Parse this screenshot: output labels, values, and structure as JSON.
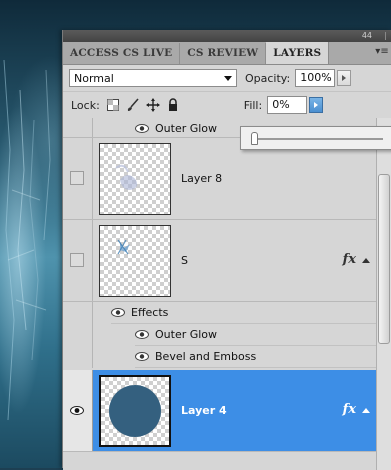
{
  "panel": {
    "collapse_glyph": "44",
    "menu_glyph": "▾≡",
    "tabs": [
      {
        "label": "ACCESS CS LIVE",
        "active": false
      },
      {
        "label": "CS REVIEW",
        "active": false
      },
      {
        "label": "LAYERS",
        "active": true
      }
    ]
  },
  "controls": {
    "blend_mode": "Normal",
    "opacity_label": "Opacity:",
    "opacity_value": "100%",
    "lock_label": "Lock:",
    "fill_label": "Fill:",
    "fill_value": "0%",
    "fill_slider_fraction": 0.0
  },
  "layers": {
    "top_effect": "Outer Glow",
    "items": [
      {
        "name": "Layer 8",
        "visible": false,
        "has_fx": false,
        "selected": false
      },
      {
        "name": "S",
        "visible": false,
        "has_fx": true,
        "selected": false,
        "effects_label": "Effects",
        "effects": [
          "Outer Glow",
          "Bevel and Emboss"
        ]
      },
      {
        "name": "Layer 4",
        "visible": true,
        "has_fx": true,
        "selected": true
      }
    ],
    "fx_label": "fx"
  },
  "colors": {
    "selection": "#3d8ee6",
    "panel": "#d6d6d6",
    "circle": "#34607f"
  }
}
